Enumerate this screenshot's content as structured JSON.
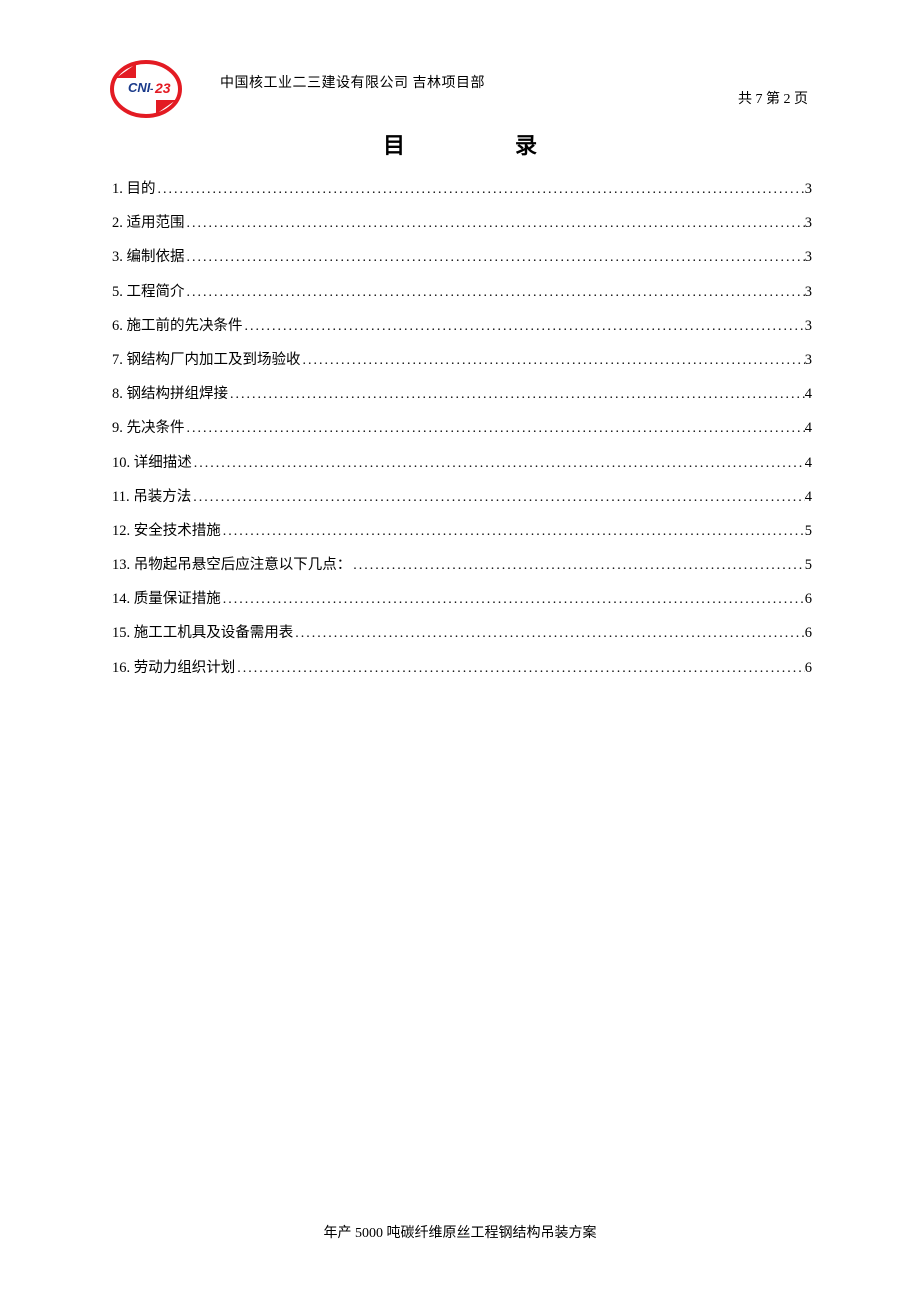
{
  "header": {
    "company": "中国核工业二三建设有限公司  吉林项目部",
    "logo_text_top": "CNI",
    "logo_text_mid": "-",
    "logo_text_num": "23"
  },
  "page_info": "共 7 第 2 页",
  "title": {
    "part1": "目",
    "part2": "录"
  },
  "toc": [
    {
      "label": "1. 目的",
      "page": "3"
    },
    {
      "label": "2. 适用范围",
      "page": "3"
    },
    {
      "label": "3. 编制依据",
      "page": "3"
    },
    {
      "label": "5. 工程简介",
      "page": "3"
    },
    {
      "label": "6. 施工前的先决条件",
      "page": "3"
    },
    {
      "label": "7. 钢结构厂内加工及到场验收",
      "page": "3"
    },
    {
      "label": "8. 钢结构拼组焊接",
      "page": "4"
    },
    {
      "label": "9.  先决条件",
      "page": "4"
    },
    {
      "label": "10.  详细描述",
      "page": "4"
    },
    {
      "label": "11.  吊装方法",
      "page": "4"
    },
    {
      "label": "12.  安全技术措施",
      "page": "5"
    },
    {
      "label": "13.  吊物起吊悬空后应注意以下几点：",
      "page": "5"
    },
    {
      "label": "14. 质量保证措施",
      "page": "6"
    },
    {
      "label": "15.  施工工机具及设备需用表",
      "page": "6"
    },
    {
      "label": "16.  劳动力组织计划",
      "page": "6"
    }
  ],
  "footer": "年产 5000 吨碳纤维原丝工程钢结构吊装方案"
}
